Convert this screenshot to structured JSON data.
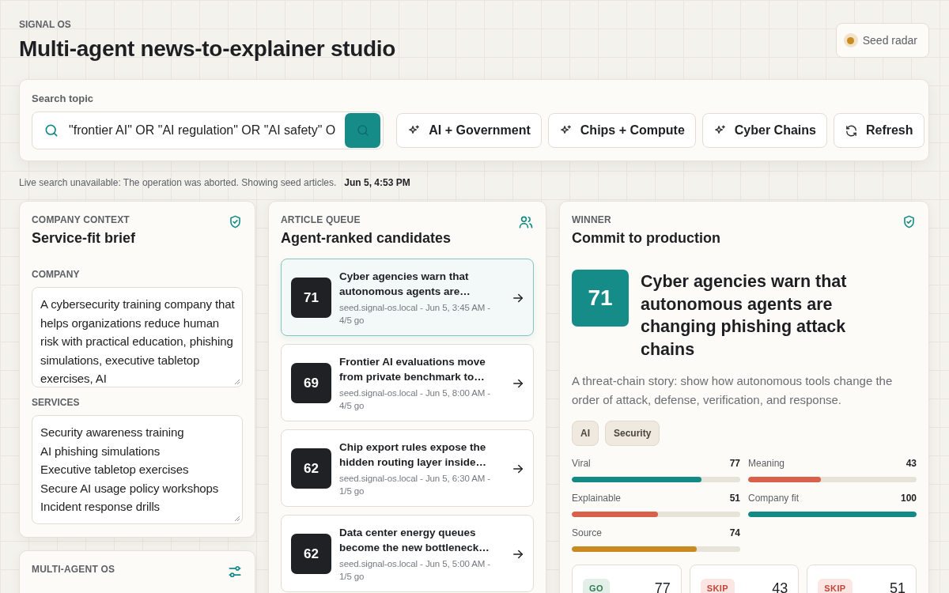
{
  "header": {
    "eyebrow": "SIGNAL OS",
    "title": "Multi-agent news-to-explainer studio",
    "badge": "Seed radar"
  },
  "search": {
    "label": "Search topic",
    "value": "\"frontier AI\" OR \"AI regulation\" OR \"AI safety\" O",
    "buttons": [
      {
        "kind": "preset",
        "label": "AI + Government"
      },
      {
        "kind": "preset",
        "label": "Chips + Compute"
      },
      {
        "kind": "preset",
        "label": "Cyber Chains"
      },
      {
        "kind": "refresh",
        "label": "Refresh"
      }
    ]
  },
  "status": {
    "message": "Live search unavailable: The operation was aborted. Showing seed articles.",
    "time": "Jun 5, 4:53 PM"
  },
  "brief": {
    "eyebrow": "COMPANY CONTEXT",
    "title": "Service-fit brief",
    "company_label": "COMPANY",
    "company": "A cybersecurity training company that helps organizations reduce human risk with practical education, phishing simulations, executive tabletop exercises, AI",
    "services_label": "SERVICES",
    "services": [
      "Security awareness training",
      "AI phishing simulations",
      "Executive tabletop exercises",
      "Secure AI usage policy workshops",
      "Incident response drills"
    ]
  },
  "agents": {
    "eyebrow": "MULTI-AGENT OS"
  },
  "queue": {
    "eyebrow": "ARTICLE QUEUE",
    "title": "Agent-ranked candidates",
    "items": [
      {
        "score": "71",
        "title": "Cyber agencies warn that autonomous agents are…",
        "meta": "seed.signal-os.local - Jun 5, 3:45 AM - 4/5 go",
        "selected": true
      },
      {
        "score": "69",
        "title": "Frontier AI evaluations move from private benchmark to…",
        "meta": "seed.signal-os.local - Jun 5, 8:00 AM - 4/5 go",
        "selected": false
      },
      {
        "score": "62",
        "title": "Chip export rules expose the hidden routing layer inside…",
        "meta": "seed.signal-os.local - Jun 5, 6:30 AM - 1/5 go",
        "selected": false
      },
      {
        "score": "62",
        "title": "Data center energy queues become the new bottleneck…",
        "meta": "seed.signal-os.local - Jun 5, 5:00 AM - 1/5 go",
        "selected": false
      }
    ]
  },
  "winner": {
    "eyebrow": "WINNER",
    "title": "Commit to production",
    "score": "71",
    "headline": "Cyber agencies warn that autonomous agents are changing phishing attack chains",
    "summary": "A threat-chain story: show how autonomous tools change the order of attack, defense, verification, and response.",
    "tags": [
      "AI",
      "Security"
    ],
    "metrics": [
      {
        "name": "Viral",
        "value": "77",
        "level": 0.77,
        "color": "#138a86"
      },
      {
        "name": "Meaning",
        "value": "43",
        "level": 0.43,
        "color": "#d9604a"
      },
      {
        "name": "Explainable",
        "value": "51",
        "level": 0.51,
        "color": "#d9604a"
      },
      {
        "name": "Company fit",
        "value": "100",
        "level": 1.0,
        "color": "#138a86"
      },
      {
        "name": "Source",
        "value": "74",
        "level": 0.74,
        "color": "#c98a1f"
      }
    ],
    "verdicts": [
      {
        "kind": "go",
        "label": "GO",
        "value": "77"
      },
      {
        "kind": "skip",
        "label": "SKIP",
        "value": "43"
      },
      {
        "kind": "skip",
        "label": "SKIP",
        "value": "51"
      }
    ]
  }
}
